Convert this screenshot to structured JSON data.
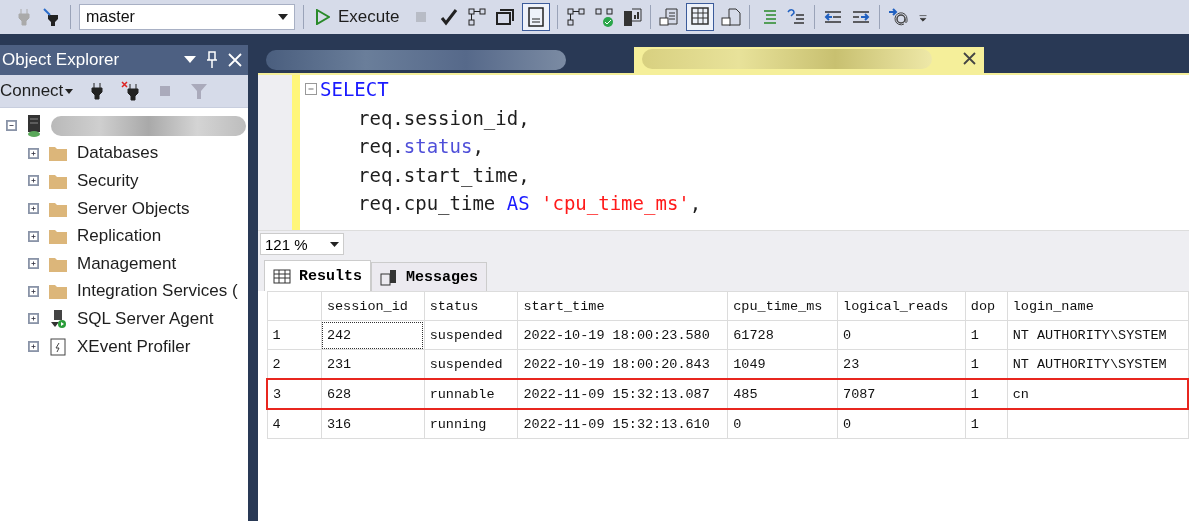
{
  "toolbar": {
    "database": "master",
    "execute": "Execute"
  },
  "object_explorer": {
    "title": "Object Explorer",
    "connect": "Connect",
    "server": {
      "expanded": true,
      "children": [
        {
          "label": "Databases",
          "kind": "folder",
          "expanded": false
        },
        {
          "label": "Security",
          "kind": "folder",
          "expanded": false
        },
        {
          "label": "Server Objects",
          "kind": "folder",
          "expanded": false
        },
        {
          "label": "Replication",
          "kind": "folder",
          "expanded": false
        },
        {
          "label": "Management",
          "kind": "folder",
          "expanded": false
        },
        {
          "label": "Integration Services (",
          "kind": "folder",
          "expanded": false
        },
        {
          "label": "SQL Server Agent",
          "kind": "agent",
          "expanded": false
        },
        {
          "label": "XEvent Profiler",
          "kind": "profiler",
          "expanded": false
        }
      ]
    }
  },
  "editor": {
    "lines": [
      [
        {
          "text": "SELECT",
          "kind": "keyword"
        }
      ],
      [
        {
          "text": "req.session_id,",
          "kind": "plain"
        }
      ],
      [
        {
          "text": "req.",
          "kind": "plain"
        },
        {
          "text": "status",
          "kind": "function"
        },
        {
          "text": ",",
          "kind": "plain"
        }
      ],
      [
        {
          "text": "req.start_time,",
          "kind": "plain"
        }
      ],
      [
        {
          "text": "req.cpu_time ",
          "kind": "plain"
        },
        {
          "text": "AS",
          "kind": "keyword"
        },
        {
          "text": " 'cpu_time_ms'",
          "kind": "string"
        },
        {
          "text": ",",
          "kind": "plain"
        }
      ]
    ],
    "zoom": "121 %"
  },
  "result_tabs": [
    {
      "label": "Results",
      "selected": true
    },
    {
      "label": "Messages",
      "selected": false
    }
  ],
  "table": {
    "columns": [
      "session_id",
      "status",
      "start_time",
      "cpu_time_ms",
      "logical_reads",
      "dop",
      "login_name"
    ],
    "rows": [
      {
        "number": "1",
        "cells": [
          "242",
          "suspended",
          "2022-10-19 18:00:23.580",
          "61728",
          "0",
          "1",
          "NT AUTHORITY\\SYSTEM"
        ],
        "outlined": false,
        "focused": true
      },
      {
        "number": "2",
        "cells": [
          "231",
          "suspended",
          "2022-10-19 18:00:20.843",
          "1049",
          "23",
          "1",
          "NT AUTHORITY\\SYSTEM"
        ],
        "outlined": false,
        "focused": false
      },
      {
        "number": "3",
        "cells": [
          "628",
          "runnable",
          "2022-11-09 15:32:13.087",
          "485",
          "7087",
          "1",
          "cn"
        ],
        "outlined": true,
        "focused": false
      },
      {
        "number": "4",
        "cells": [
          "316",
          "running",
          "2022-11-09 15:32:13.610",
          "0",
          "0",
          "1"
        ],
        "outlined": false,
        "focused": false
      }
    ]
  }
}
